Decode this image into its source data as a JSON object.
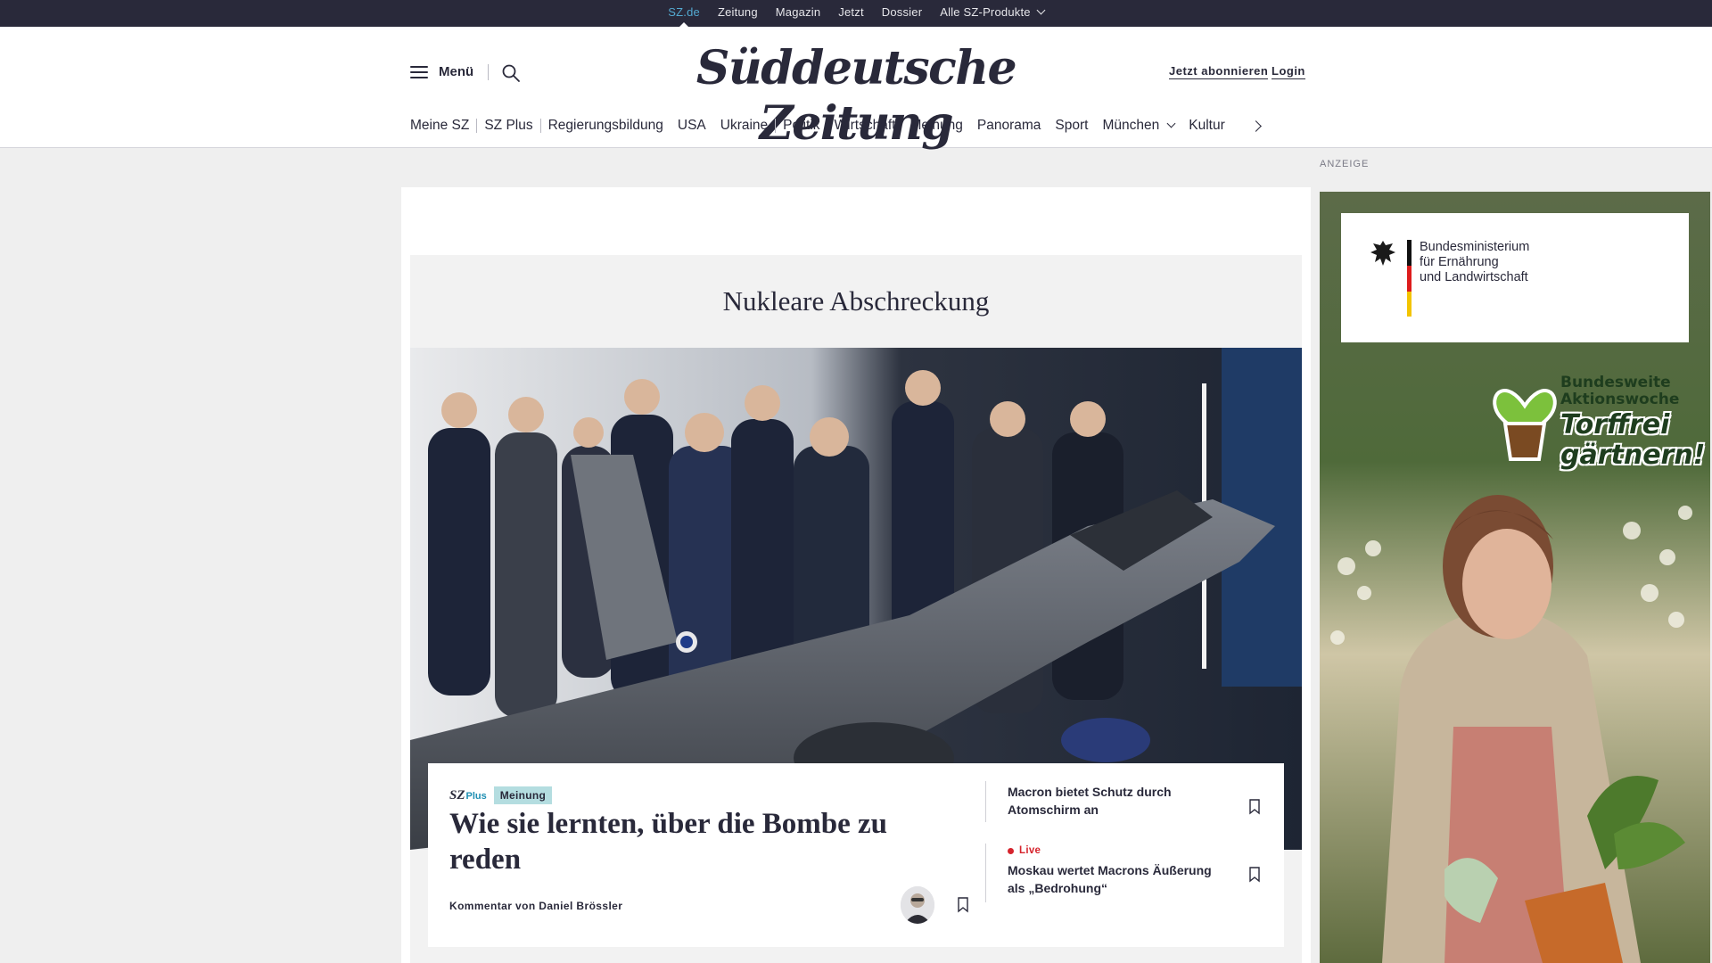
{
  "topbar": {
    "items": [
      "SZ.de",
      "Zeitung",
      "Magazin",
      "Jetzt",
      "Dossier",
      "Alle SZ-Produkte"
    ]
  },
  "header": {
    "menu_label": "Menü",
    "logo": "Süddeutsche Zeitung",
    "subscribe": "Jetzt abonnieren",
    "login": "Login"
  },
  "nav": {
    "items": [
      "Meine SZ",
      "SZ Plus",
      "Regierungsbildung",
      "USA",
      "Ukraine",
      "Politik",
      "Wirtschaft",
      "Meinung",
      "Panorama",
      "Sport",
      "München",
      "Kultur"
    ]
  },
  "section": {
    "title": "Nukleare Abschreckung"
  },
  "article": {
    "sz_brand": "SZ",
    "plus_label": "Plus",
    "badge": "Meinung",
    "headline": "Wie sie lernten, über die Bombe zu reden",
    "byline": "Kommentar von Daniel Brössler"
  },
  "related": [
    {
      "title": "Macron bietet Schutz durch Atomschirm an",
      "live": ""
    },
    {
      "title": "Moskau wertet Macrons Äußerung als „Bedrohung“",
      "live": "Live"
    }
  ],
  "ad": {
    "label": "ANZEIGE",
    "ministry_line1": "Bundesministerium",
    "ministry_line2": "für Ernährung",
    "ministry_line3": "und Landwirtschaft",
    "campaign_line1": "Bundesweite",
    "campaign_line2": "Aktionswoche",
    "campaign_line3": "Torffrei",
    "campaign_line4": "gärtnern!"
  },
  "colors": {
    "dark": "#29293a",
    "accent_blue": "#53a9d0",
    "badge_bg": "#b4dde0",
    "live_red": "#d6242d"
  }
}
